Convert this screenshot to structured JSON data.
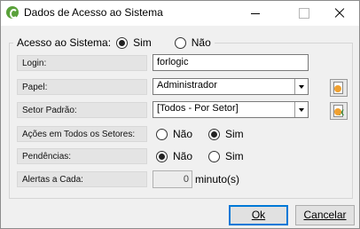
{
  "window": {
    "title": "Dados de Acesso ao Sistema",
    "accent": "#0078d7"
  },
  "access": {
    "label": "Acesso ao Sistema:",
    "options": [
      {
        "label": "Sim",
        "checked": true
      },
      {
        "label": "Não",
        "checked": false
      }
    ]
  },
  "fields": {
    "login": {
      "label": "Login:",
      "value": "forlogic"
    },
    "papel": {
      "label": "Papel:",
      "value": "Administrador"
    },
    "setor": {
      "label": "Setor Padrão:",
      "value": "[Todos - Por Setor]"
    },
    "acoes": {
      "label": "Ações em Todos os Setores:",
      "options": [
        {
          "label": "Não",
          "checked": false
        },
        {
          "label": "Sim",
          "checked": true
        }
      ]
    },
    "pendencias": {
      "label": "Pendências:",
      "options": [
        {
          "label": "Não",
          "checked": true
        },
        {
          "label": "Sim",
          "checked": false
        }
      ]
    },
    "alertas": {
      "label": "Alertas a Cada:",
      "value": "0",
      "unit": "minuto(s)"
    }
  },
  "buttons": {
    "ok": "Ok",
    "cancel": "Cancelar"
  },
  "icons": {
    "app": "app-logo-icon",
    "papel_action": "document-add-icon",
    "setor_action": "spreadsheet-icon"
  }
}
